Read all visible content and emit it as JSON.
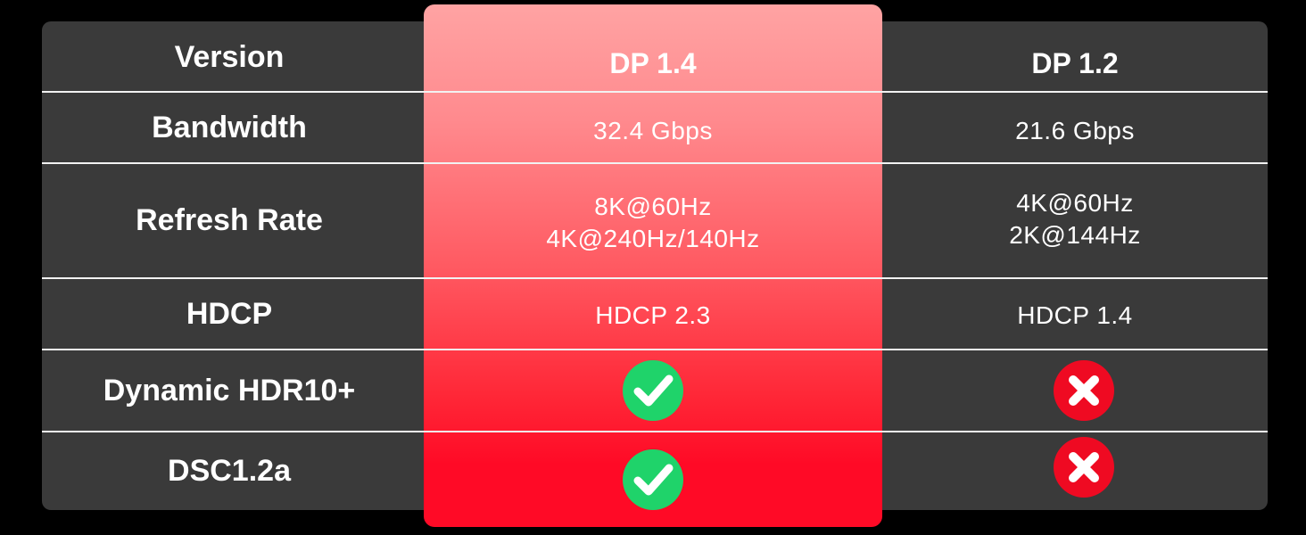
{
  "table": {
    "header": {
      "label": "Version",
      "col_dp14": "DP 1.4",
      "col_dp12": "DP 1.2"
    },
    "rows": [
      {
        "label": "Bandwidth",
        "dp14": "32.4 Gbps",
        "dp12": "21.6 Gbps"
      },
      {
        "label": "Refresh Rate",
        "dp14": "8K@60Hz\n4K@240Hz/140Hz",
        "dp12": "4K@60Hz\n2K@144Hz"
      },
      {
        "label": "HDCP",
        "dp14": "HDCP 2.3",
        "dp12": "HDCP 1.4"
      },
      {
        "label": "Dynamic HDR10+",
        "dp14_icon": "check-icon",
        "dp12_icon": "cross-icon"
      },
      {
        "label": "DSC1.2a",
        "dp14_icon": "check-icon",
        "dp12_icon": "cross-icon"
      }
    ]
  },
  "colors": {
    "background": "#000000",
    "table": "#3a3a3a",
    "highlight_top": "#ffa3a3",
    "highlight_bottom": "#ff0a26",
    "check": "#1fd36a",
    "cross": "#ef0a22"
  }
}
